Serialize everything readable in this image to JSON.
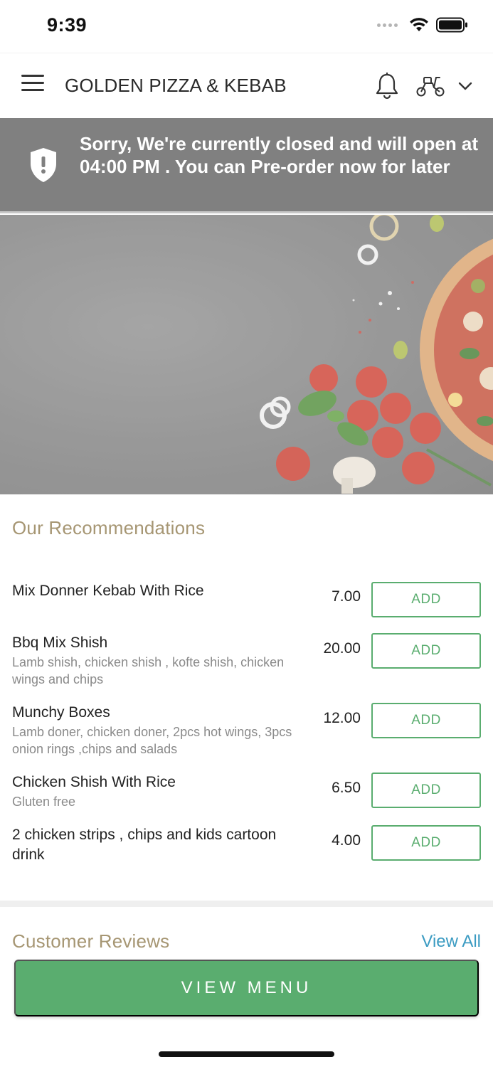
{
  "status_bar": {
    "time": "9:39"
  },
  "header": {
    "store_name": "GOLDEN PIZZA & KEBAB",
    "icons": [
      "menu-icon",
      "bell-icon",
      "scooter-icon",
      "chevron-down-icon"
    ]
  },
  "banner": {
    "text": "Sorry, We're currently closed and will open at 04:00 PM . You can Pre-order now for later",
    "background": "#808080",
    "icon": "shield-alert-icon"
  },
  "recommendations": {
    "title": "Our Recommendations",
    "items": [
      {
        "name": "Mix Donner Kebab With Rice",
        "description": "",
        "price": "7.00",
        "button": "ADD"
      },
      {
        "name": "Bbq Mix Shish",
        "description": "Lamb shish, chicken shish , kofte shish, chicken wings and chips",
        "price": "20.00",
        "button": "ADD"
      },
      {
        "name": "Munchy Boxes",
        "description": "Lamb doner, chicken doner, 2pcs hot wings, 3pcs onion rings ,chips and salads",
        "price": "12.00",
        "button": "ADD"
      },
      {
        "name": "Chicken Shish With Rice",
        "description": "Gluten free",
        "price": "6.50",
        "button": "ADD"
      },
      {
        "name": "2 chicken strips , chips and kids cartoon drink",
        "description": "",
        "price": "4.00",
        "button": "ADD"
      }
    ]
  },
  "reviews": {
    "title": "Customer Reviews",
    "view_all": "View All"
  },
  "footer": {
    "view_menu": "VIEW MENU"
  },
  "colors": {
    "accent_green": "#5aad6f",
    "section_title": "#a69673",
    "link_blue": "#3b9bc2"
  }
}
